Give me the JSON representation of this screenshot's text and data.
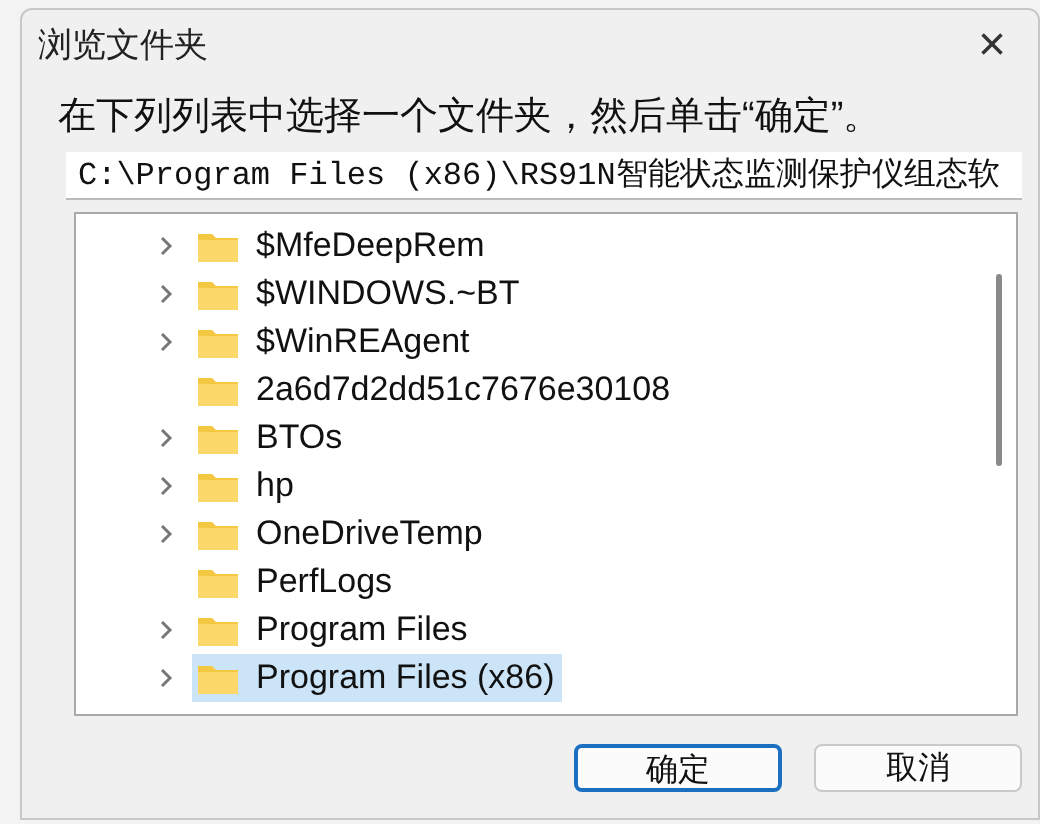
{
  "window": {
    "title": "浏览文件夹",
    "close": "×"
  },
  "instruction": "在下列列表中选择一个文件夹，然后单击“确定”。",
  "path_field": {
    "value": "C:\\Program Files (x86)\\RS91N智能状态监测保护仪组态软"
  },
  "tree": {
    "items": [
      {
        "label": "$MfeDeepRem",
        "expandable": true,
        "selected": false
      },
      {
        "label": "$WINDOWS.~BT",
        "expandable": true,
        "selected": false
      },
      {
        "label": "$WinREAgent",
        "expandable": true,
        "selected": false
      },
      {
        "label": "2a6d7d2dd51c7676e30108",
        "expandable": false,
        "selected": false
      },
      {
        "label": "BTOs",
        "expandable": true,
        "selected": false
      },
      {
        "label": "hp",
        "expandable": true,
        "selected": false
      },
      {
        "label": "OneDriveTemp",
        "expandable": true,
        "selected": false
      },
      {
        "label": "PerfLogs",
        "expandable": false,
        "selected": false
      },
      {
        "label": "Program Files",
        "expandable": true,
        "selected": false
      },
      {
        "label": "Program Files (x86)",
        "expandable": true,
        "selected": true
      }
    ]
  },
  "buttons": [
    {
      "label": "确定",
      "kind": "default"
    },
    {
      "label": "取消",
      "kind": "normal"
    }
  ]
}
